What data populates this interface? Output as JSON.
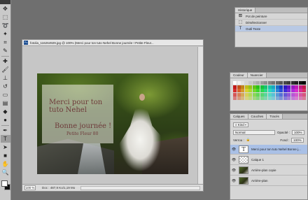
{
  "document": {
    "title": "fotolia_116264929.jpg @ 100% (Merci pour  ton tuto Nehel  Bonne journée !  Petite Fleur...",
    "zoom": "100 %",
    "doc_info": "Doc : 487,9 Ko/1,19 Mo",
    "overlay_text": {
      "line1": "Merci pour  ton",
      "line2": "tuto Nehel",
      "line3": "Bonne journée !",
      "line4": "Petite Fleur 80"
    }
  },
  "history_panel": {
    "tab": "Historique",
    "items": [
      {
        "icon": "paint-bucket-icon",
        "label": "Pot de peinture",
        "selected": false
      },
      {
        "icon": "deselect-icon",
        "label": "Désélectionner",
        "selected": false
      },
      {
        "icon": "text-tool-icon",
        "label": "Outil Texte",
        "selected": true
      }
    ]
  },
  "swatches_panel": {
    "tabs": [
      "Couleur",
      "Nuancier"
    ],
    "active_tab": "Nuancier"
  },
  "layers_panel": {
    "tabs": [
      "Calques",
      "Couches",
      "Tracés"
    ],
    "kind_label": "Kind",
    "blend_mode": "Normal",
    "opacity_label": "Opacité :",
    "opacity_value": "100%",
    "lock_label": "Verrou :",
    "fill_label": "Fond :",
    "fill_value": "100%",
    "layers": [
      {
        "name": "Merci pour  ton tuto Nehel  Bonne j...",
        "thumb": "T",
        "selected": true
      },
      {
        "name": "Calque 1",
        "thumb": "",
        "selected": false
      },
      {
        "name": "Arrière-plan copie",
        "thumb": "",
        "selected": false
      },
      {
        "name": "Arrière-plan",
        "thumb": "",
        "selected": false
      }
    ]
  },
  "colors": {
    "foreground": "#ffffff",
    "background": "#111111",
    "selection": "#a9c0e6"
  }
}
